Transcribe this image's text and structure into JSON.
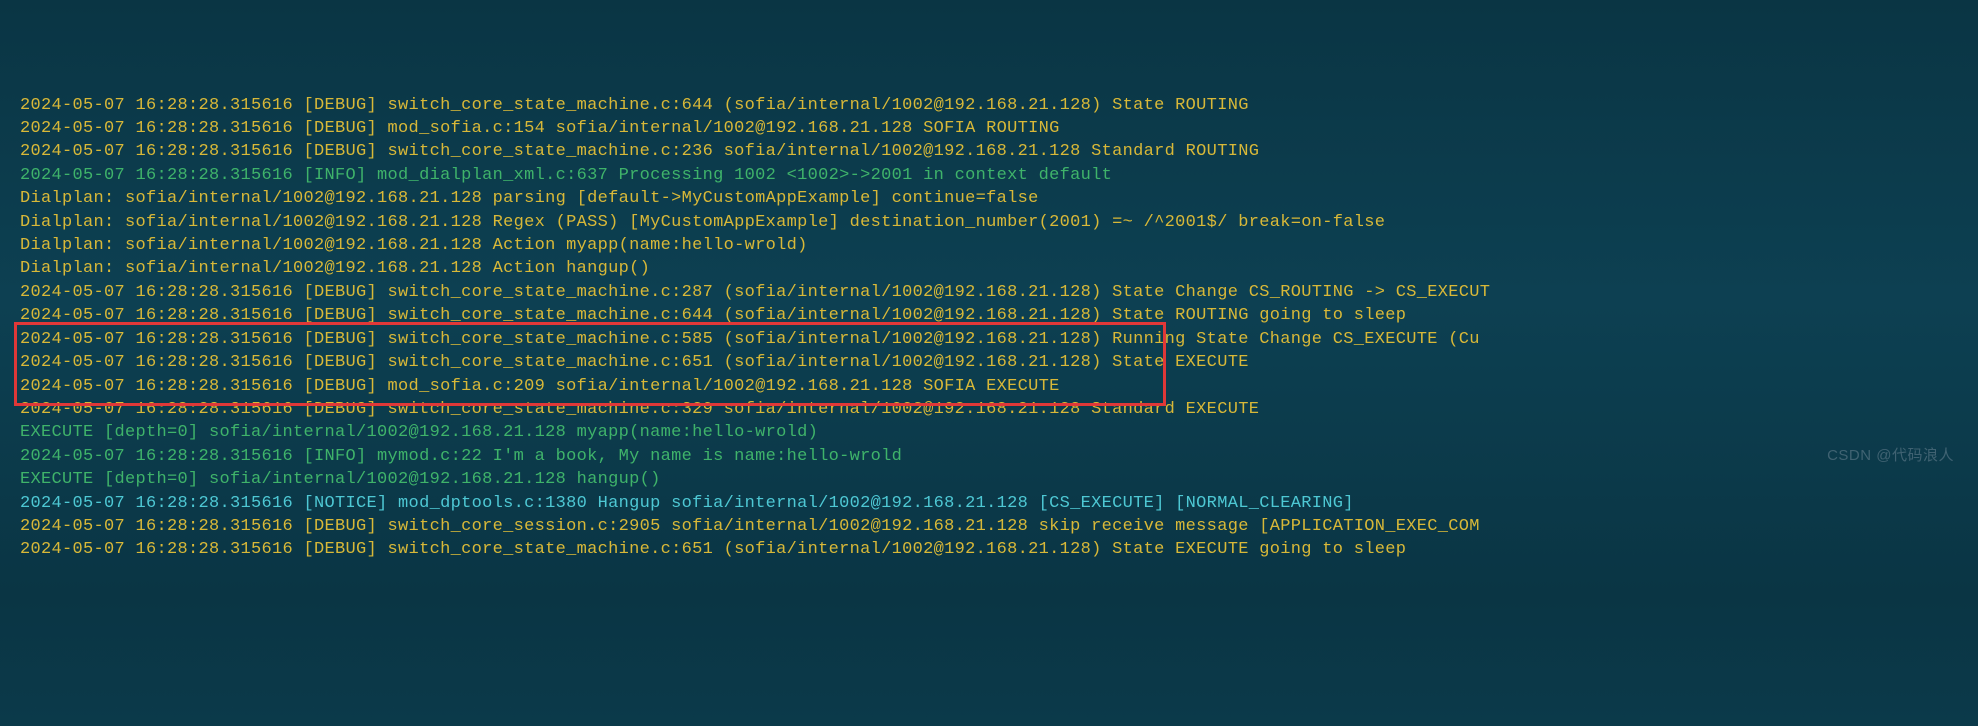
{
  "watermark": "CSDN @代码浪人",
  "lines": [
    {
      "cls": "yellow",
      "text": "2024-05-07 16:28:28.315616 [DEBUG] switch_core_state_machine.c:644 (sofia/internal/1002@192.168.21.128) State ROUTING"
    },
    {
      "cls": "yellow",
      "text": "2024-05-07 16:28:28.315616 [DEBUG] mod_sofia.c:154 sofia/internal/1002@192.168.21.128 SOFIA ROUTING"
    },
    {
      "cls": "yellow",
      "text": "2024-05-07 16:28:28.315616 [DEBUG] switch_core_state_machine.c:236 sofia/internal/1002@192.168.21.128 Standard ROUTING"
    },
    {
      "cls": "green",
      "text": "2024-05-07 16:28:28.315616 [INFO] mod_dialplan_xml.c:637 Processing 1002 <1002>->2001 in context default"
    },
    {
      "cls": "yellow",
      "text": "Dialplan: sofia/internal/1002@192.168.21.128 parsing [default->MyCustomAppExample] continue=false"
    },
    {
      "cls": "yellow",
      "text": "Dialplan: sofia/internal/1002@192.168.21.128 Regex (PASS) [MyCustomAppExample] destination_number(2001) =~ /^2001$/ break=on-false"
    },
    {
      "cls": "yellow",
      "text": "Dialplan: sofia/internal/1002@192.168.21.128 Action myapp(name:hello-wrold)"
    },
    {
      "cls": "yellow",
      "text": "Dialplan: sofia/internal/1002@192.168.21.128 Action hangup()"
    },
    {
      "cls": "yellow",
      "text": "2024-05-07 16:28:28.315616 [DEBUG] switch_core_state_machine.c:287 (sofia/internal/1002@192.168.21.128) State Change CS_ROUTING -> CS_EXECUT"
    },
    {
      "cls": "yellow",
      "text": "2024-05-07 16:28:28.315616 [DEBUG] switch_core_state_machine.c:644 (sofia/internal/1002@192.168.21.128) State ROUTING going to sleep"
    },
    {
      "cls": "yellow",
      "text": "2024-05-07 16:28:28.315616 [DEBUG] switch_core_state_machine.c:585 (sofia/internal/1002@192.168.21.128) Running State Change CS_EXECUTE (Cu"
    },
    {
      "cls": "yellow",
      "text": "2024-05-07 16:28:28.315616 [DEBUG] switch_core_state_machine.c:651 (sofia/internal/1002@192.168.21.128) State EXECUTE"
    },
    {
      "cls": "yellow",
      "text": "2024-05-07 16:28:28.315616 [DEBUG] mod_sofia.c:209 sofia/internal/1002@192.168.21.128 SOFIA EXECUTE"
    },
    {
      "cls": "yellow",
      "text": "2024-05-07 16:28:28.315616 [DEBUG] switch_core_state_machine.c:329 sofia/internal/1002@192.168.21.128 Standard EXECUTE"
    },
    {
      "cls": "green",
      "text": "EXECUTE [depth=0] sofia/internal/1002@192.168.21.128 myapp(name:hello-wrold)"
    },
    {
      "cls": "green",
      "text": "2024-05-07 16:28:28.315616 [INFO] mymod.c:22 I'm a book, My name is name:hello-wrold"
    },
    {
      "cls": "green",
      "text": "EXECUTE [depth=0] sofia/internal/1002@192.168.21.128 hangup()"
    },
    {
      "cls": "cyan",
      "text": "2024-05-07 16:28:28.315616 [NOTICE] mod_dptools.c:1380 Hangup sofia/internal/1002@192.168.21.128 [CS_EXECUTE] [NORMAL_CLEARING]"
    },
    {
      "cls": "yellow",
      "text": "2024-05-07 16:28:28.315616 [DEBUG] switch_core_session.c:2905 sofia/internal/1002@192.168.21.128 skip receive message [APPLICATION_EXEC_COM"
    },
    {
      "cls": "yellow",
      "text": "2024-05-07 16:28:28.315616 [DEBUG] switch_core_state_machine.c:651 (sofia/internal/1002@192.168.21.128) State EXECUTE going to sleep"
    }
  ]
}
